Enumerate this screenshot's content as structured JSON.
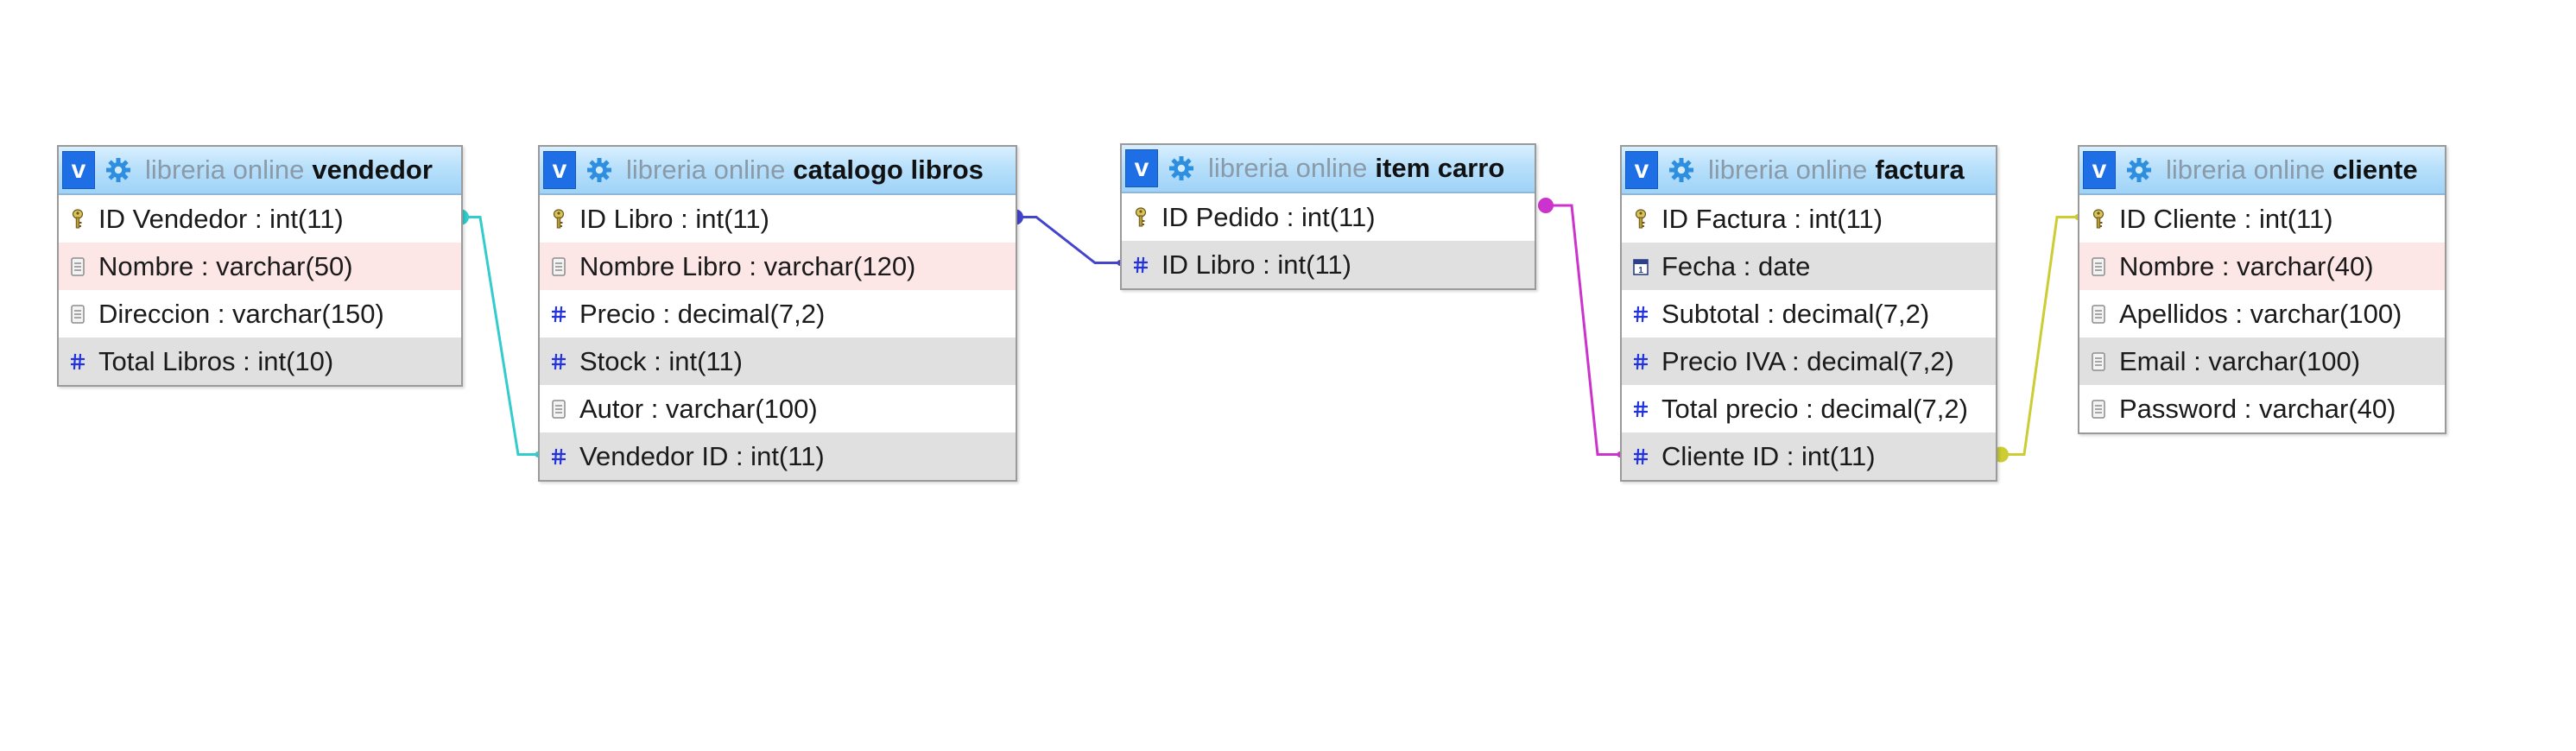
{
  "diagram": {
    "tables": [
      {
        "id": "vendedor",
        "database": "libreria online",
        "name": "vendedor",
        "columns": [
          {
            "label": "ID Vendedor : int(11)",
            "icon": "key-icon",
            "style": "white"
          },
          {
            "label": "Nombre : varchar(50)",
            "icon": "text-field-icon",
            "style": "pink"
          },
          {
            "label": "Direccion : varchar(150)",
            "icon": "text-field-icon",
            "style": "white"
          },
          {
            "label": "Total Libros : int(10)",
            "icon": "numeric-field-icon",
            "style": "grey"
          }
        ]
      },
      {
        "id": "catalogo",
        "database": "libreria online",
        "name": "catalogo libros",
        "columns": [
          {
            "label": "ID Libro : int(11)",
            "icon": "key-icon",
            "style": "white"
          },
          {
            "label": "Nombre Libro : varchar(120)",
            "icon": "text-field-icon",
            "style": "pink"
          },
          {
            "label": "Precio : decimal(7,2)",
            "icon": "numeric-field-icon",
            "style": "white"
          },
          {
            "label": "Stock : int(11)",
            "icon": "numeric-field-icon",
            "style": "grey"
          },
          {
            "label": "Autor : varchar(100)",
            "icon": "text-field-icon",
            "style": "white"
          },
          {
            "label": "Vendedor ID : int(11)",
            "icon": "numeric-field-icon",
            "style": "grey"
          }
        ]
      },
      {
        "id": "itemcarro",
        "database": "libreria online",
        "name": "item carro",
        "columns": [
          {
            "label": "ID Pedido : int(11)",
            "icon": "key-icon",
            "style": "white"
          },
          {
            "label": "ID Libro : int(11)",
            "icon": "numeric-field-icon",
            "style": "grey"
          }
        ]
      },
      {
        "id": "factura",
        "database": "libreria online",
        "name": "factura",
        "columns": [
          {
            "label": "ID Factura : int(11)",
            "icon": "key-icon",
            "style": "white"
          },
          {
            "label": "Fecha : date",
            "icon": "date-field-icon",
            "style": "grey"
          },
          {
            "label": "Subtotal : decimal(7,2)",
            "icon": "numeric-field-icon",
            "style": "white"
          },
          {
            "label": "Precio IVA : decimal(7,2)",
            "icon": "numeric-field-icon",
            "style": "grey"
          },
          {
            "label": "Total precio : decimal(7,2)",
            "icon": "numeric-field-icon",
            "style": "white"
          },
          {
            "label": "Cliente ID : int(11)",
            "icon": "numeric-field-icon",
            "style": "grey"
          }
        ]
      },
      {
        "id": "cliente",
        "database": "libreria online",
        "name": "cliente",
        "columns": [
          {
            "label": "ID Cliente : int(11)",
            "icon": "key-icon",
            "style": "white"
          },
          {
            "label": "Nombre : varchar(40)",
            "icon": "text-field-icon",
            "style": "pink"
          },
          {
            "label": "Apellidos : varchar(100)",
            "icon": "text-field-icon",
            "style": "white"
          },
          {
            "label": "Email : varchar(100)",
            "icon": "text-field-icon",
            "style": "grey"
          },
          {
            "label": "Password : varchar(40)",
            "icon": "text-field-icon",
            "style": "white"
          }
        ]
      }
    ],
    "relations": [
      {
        "from_table": "vendedor",
        "from_column": "ID Vendedor",
        "to_table": "catalogo libros",
        "to_column": "Vendedor ID",
        "color": "#33cccc"
      },
      {
        "from_table": "catalogo libros",
        "from_column": "ID Libro",
        "to_table": "item carro",
        "to_column": "ID Libro",
        "color": "#4444cc"
      },
      {
        "from_table": "factura",
        "from_column": "ID Factura",
        "to_table": "factura",
        "to_column": "Cliente ID",
        "color": "#cc33cc"
      },
      {
        "from_table": "cliente",
        "from_column": "ID Cliente",
        "to_table": "factura",
        "to_column": "Cliente ID",
        "color": "#cccc33"
      }
    ],
    "colors": {
      "header_gradient_top": "#d9efff",
      "header_gradient_bottom": "#9fd3f7",
      "toggle_blue": "#1e6ee6",
      "row_pink": "#fde6e6",
      "row_grey": "#e0e0e0",
      "numeric_icon": "#2233dd"
    }
  }
}
